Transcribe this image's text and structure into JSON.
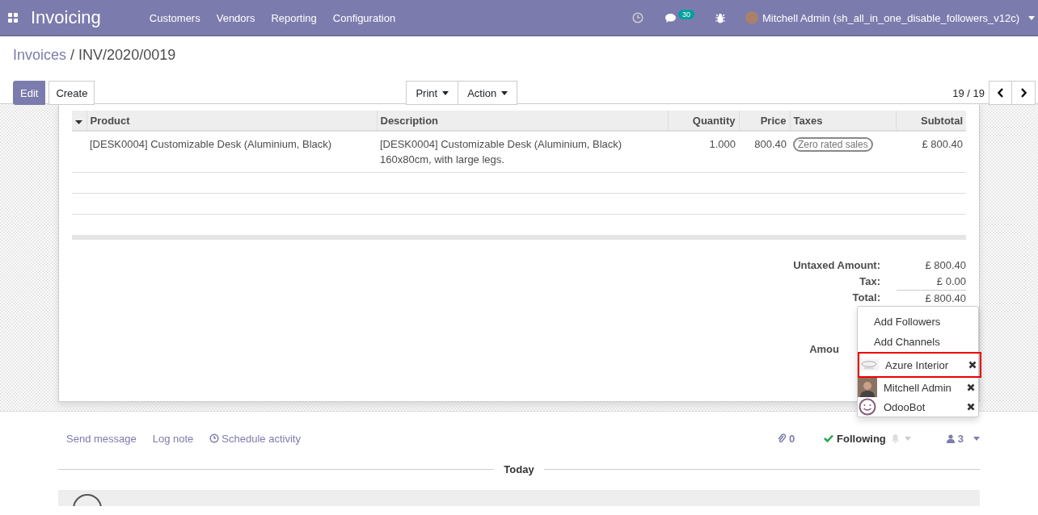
{
  "app": {
    "title": "Invoicing"
  },
  "menu": [
    {
      "label": "Customers"
    },
    {
      "label": "Vendors"
    },
    {
      "label": "Reporting"
    },
    {
      "label": "Configuration"
    }
  ],
  "systray": {
    "messages_count": "30",
    "user": "Mitchell Admin (sh_all_in_one_disable_followers_v12c)"
  },
  "breadcrumb": {
    "parent": "Invoices",
    "separator": "/",
    "current": "INV/2020/0019"
  },
  "buttons": [
    "Edit",
    "Create"
  ],
  "dropdowns": [
    "Print",
    "Action"
  ],
  "pager": "19 / 19",
  "table": {
    "columns": [
      "Product",
      "Description",
      "Quantity",
      "Price",
      "Taxes",
      "Subtotal"
    ],
    "rows": [
      {
        "product": "[DESK0004] Customizable Desk (Aluminium, Black)",
        "description": "[DESK0004] Customizable Desk (Aluminium, Black)\n160x80cm, with large legs.",
        "quantity": "1.000",
        "price": "800.40",
        "taxes": [
          "Zero rated sales"
        ],
        "subtotal": "£ 800.40"
      }
    ]
  },
  "totals": [
    {
      "label": "Untaxed Amount:",
      "value": "£ 800.40"
    },
    {
      "label": "Tax:",
      "value": "£ 0.00"
    },
    {
      "label": "Total:",
      "value": "£ 800.40",
      "kind": "total"
    },
    {
      "label": "Amou",
      "kind": "due"
    }
  ],
  "followers_menu": {
    "actions": [
      "Add Followers",
      "Add Channels"
    ],
    "followers": [
      {
        "name": "Azure Interior",
        "kind": "logo",
        "highlighted": true
      },
      {
        "name": "Mitchell Admin",
        "kind": "photo",
        "highlighted": false
      },
      {
        "name": "OdooBot",
        "kind": "bot",
        "highlighted": false
      }
    ]
  },
  "chatter": {
    "actions": [
      {
        "label": "Send message",
        "kind": "message"
      },
      {
        "label": "Log note",
        "kind": "note"
      },
      {
        "label": "Schedule activity",
        "kind": "activity"
      }
    ],
    "attachments": "0",
    "follow": "Following",
    "followers_count": "3"
  },
  "date_separator": "Today"
}
